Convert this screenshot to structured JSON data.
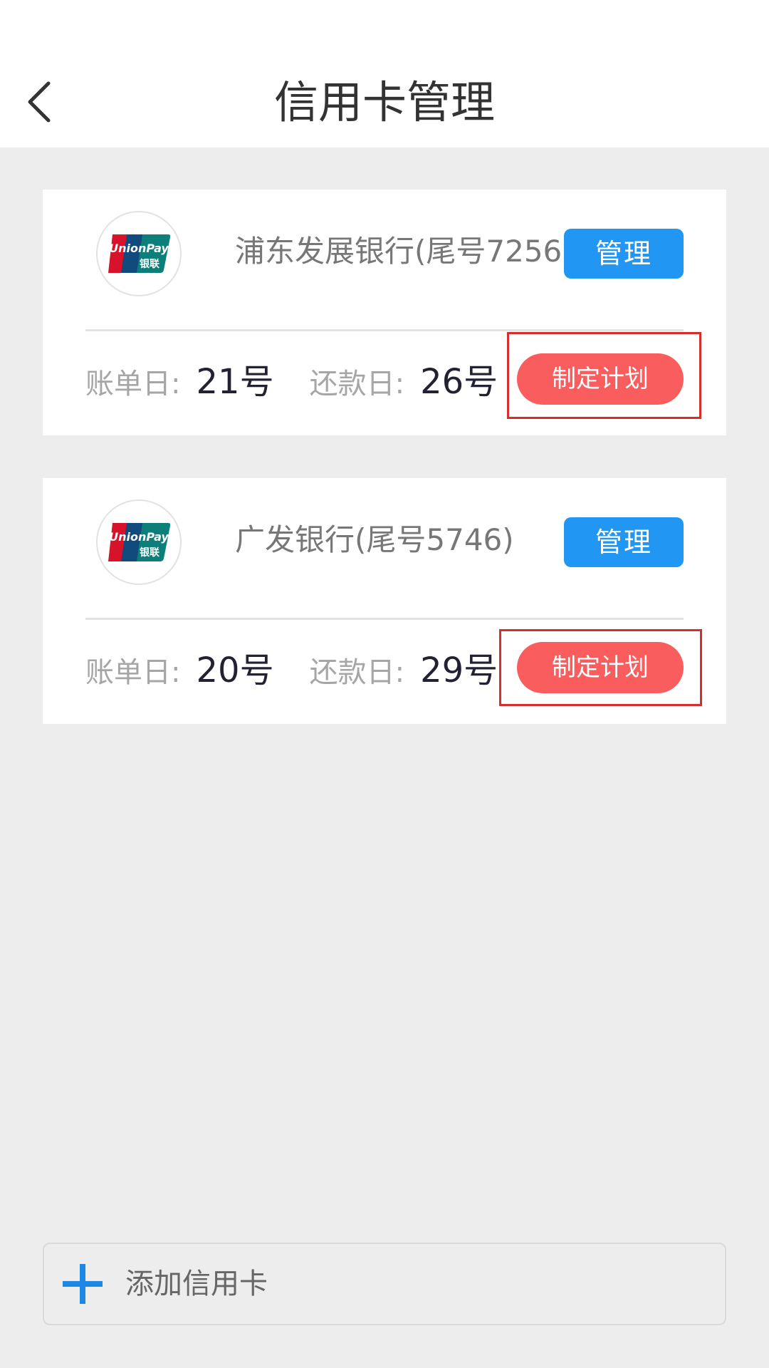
{
  "header": {
    "title": "信用卡管理",
    "back_icon": "chevron-left-icon"
  },
  "cards": [
    {
      "bank": "浦东发展银行(尾号7256)",
      "manage_label": "管理",
      "bill_day_label": "账单日:",
      "bill_day": "21号",
      "repay_day_label": "还款日:",
      "repay_day": "26号",
      "plan_label": "制定计划",
      "logo": "unionpay-logo"
    },
    {
      "bank": "广发银行(尾号5746)",
      "manage_label": "管理",
      "bill_day_label": "账单日:",
      "bill_day": "20号",
      "repay_day_label": "还款日:",
      "repay_day": "29号",
      "plan_label": "制定计划",
      "logo": "unionpay-logo"
    }
  ],
  "footer": {
    "add_label": "添加信用卡",
    "add_icon": "plus-icon"
  },
  "colors": {
    "manage_button": "#2196f3",
    "plan_button": "#f95d5d",
    "highlight_frame": "#d32f2f",
    "background": "#ededed"
  },
  "unionpay_logo_text": {
    "brand": "UnionPay",
    "chinese": "银联"
  }
}
